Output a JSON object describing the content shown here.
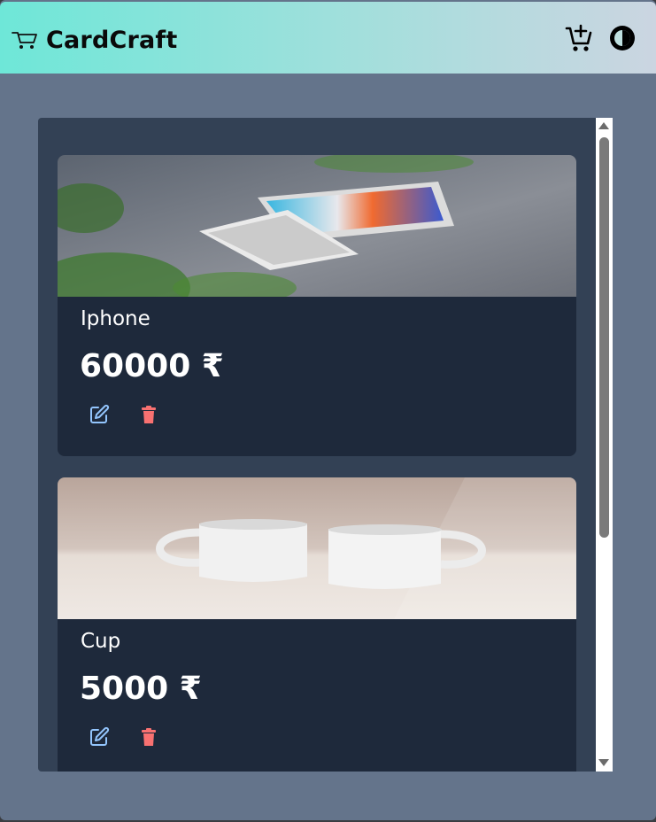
{
  "app": {
    "title": "CardCraft",
    "brand_icon": "cart-icon",
    "accent_gradient": [
      "#6ee7d8",
      "#cbd5e1"
    ]
  },
  "navbar": {
    "cart_button_icon": "add-to-cart-icon",
    "theme_button_icon": "theme-toggle-icon"
  },
  "products": [
    {
      "name": "Iphone",
      "price": "60000 ₹",
      "image": "iphone-photo"
    },
    {
      "name": "Cup",
      "price": "5000 ₹",
      "image": "cups-photo"
    }
  ],
  "actions": {
    "edit_icon": "edit-icon",
    "edit_color": "#93c5fd",
    "delete_icon": "trash-icon",
    "delete_color": "#f87171"
  }
}
